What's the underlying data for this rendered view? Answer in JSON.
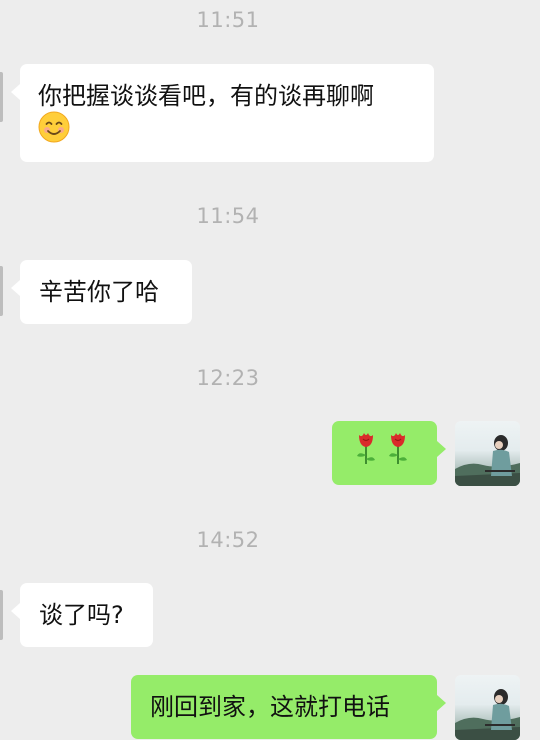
{
  "messages": [
    {
      "type": "timestamp",
      "text": "11:51"
    },
    {
      "type": "incoming",
      "text": "你把握谈谈看吧，有的谈再聊啊",
      "emoji": "smiling-face"
    },
    {
      "type": "timestamp",
      "text": "11:54"
    },
    {
      "type": "incoming",
      "text": "辛苦你了哈"
    },
    {
      "type": "timestamp",
      "text": "12:23"
    },
    {
      "type": "outgoing",
      "emojis": [
        "rose",
        "rose"
      ]
    },
    {
      "type": "timestamp",
      "text": "14:52"
    },
    {
      "type": "incoming",
      "text": "谈了吗?"
    },
    {
      "type": "outgoing",
      "text": "刚回到家，这就打电话"
    }
  ],
  "colors": {
    "background": "#ededed",
    "incoming_bubble": "#ffffff",
    "outgoing_bubble": "#95ec69",
    "timestamp": "#b2b2b2"
  }
}
